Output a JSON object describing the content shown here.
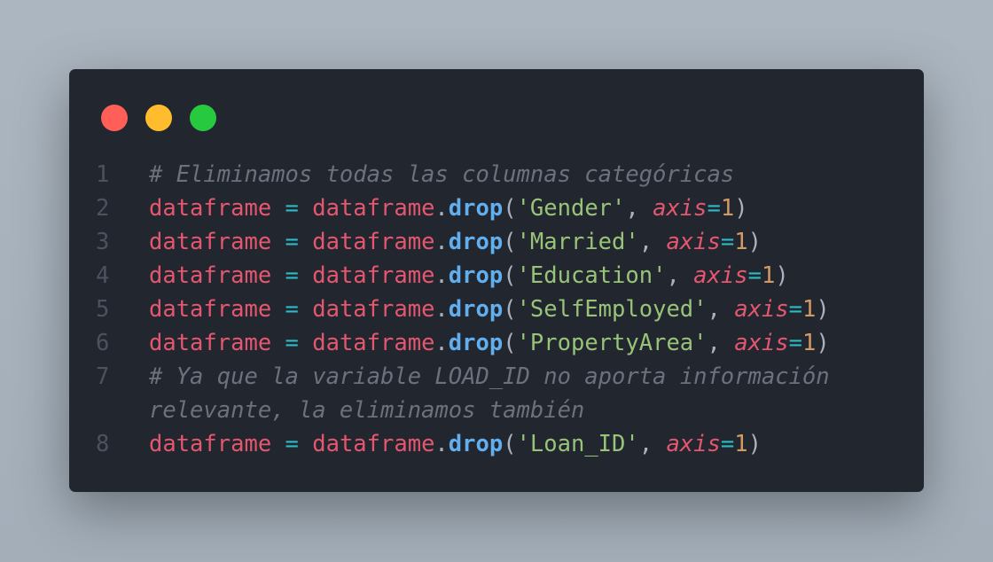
{
  "window": {
    "buttons": [
      {
        "name": "close",
        "color": "#ff5f56"
      },
      {
        "name": "minimize",
        "color": "#ffbd2e"
      },
      {
        "name": "maximize",
        "color": "#27c93f"
      }
    ]
  },
  "code": {
    "lines": [
      {
        "n": "1",
        "tokens": [
          {
            "t": "# Eliminamos todas las columnas categóricas",
            "c": "comment"
          }
        ]
      },
      {
        "n": "2",
        "tokens": [
          {
            "t": "dataframe",
            "c": "var"
          },
          {
            "t": " ",
            "c": "punc"
          },
          {
            "t": "=",
            "c": "op"
          },
          {
            "t": " ",
            "c": "punc"
          },
          {
            "t": "dataframe",
            "c": "var"
          },
          {
            "t": ".",
            "c": "punc"
          },
          {
            "t": "drop",
            "c": "fn"
          },
          {
            "t": "(",
            "c": "punc"
          },
          {
            "t": "'Gender'",
            "c": "str"
          },
          {
            "t": ", ",
            "c": "punc"
          },
          {
            "t": "axis",
            "c": "kw"
          },
          {
            "t": "=",
            "c": "op"
          },
          {
            "t": "1",
            "c": "num"
          },
          {
            "t": ")",
            "c": "punc"
          }
        ]
      },
      {
        "n": "3",
        "tokens": [
          {
            "t": "dataframe",
            "c": "var"
          },
          {
            "t": " ",
            "c": "punc"
          },
          {
            "t": "=",
            "c": "op"
          },
          {
            "t": " ",
            "c": "punc"
          },
          {
            "t": "dataframe",
            "c": "var"
          },
          {
            "t": ".",
            "c": "punc"
          },
          {
            "t": "drop",
            "c": "fn"
          },
          {
            "t": "(",
            "c": "punc"
          },
          {
            "t": "'Married'",
            "c": "str"
          },
          {
            "t": ", ",
            "c": "punc"
          },
          {
            "t": "axis",
            "c": "kw"
          },
          {
            "t": "=",
            "c": "op"
          },
          {
            "t": "1",
            "c": "num"
          },
          {
            "t": ")",
            "c": "punc"
          }
        ]
      },
      {
        "n": "4",
        "tokens": [
          {
            "t": "dataframe",
            "c": "var"
          },
          {
            "t": " ",
            "c": "punc"
          },
          {
            "t": "=",
            "c": "op"
          },
          {
            "t": " ",
            "c": "punc"
          },
          {
            "t": "dataframe",
            "c": "var"
          },
          {
            "t": ".",
            "c": "punc"
          },
          {
            "t": "drop",
            "c": "fn"
          },
          {
            "t": "(",
            "c": "punc"
          },
          {
            "t": "'Education'",
            "c": "str"
          },
          {
            "t": ", ",
            "c": "punc"
          },
          {
            "t": "axis",
            "c": "kw"
          },
          {
            "t": "=",
            "c": "op"
          },
          {
            "t": "1",
            "c": "num"
          },
          {
            "t": ")",
            "c": "punc"
          }
        ]
      },
      {
        "n": "5",
        "tokens": [
          {
            "t": "dataframe",
            "c": "var"
          },
          {
            "t": " ",
            "c": "punc"
          },
          {
            "t": "=",
            "c": "op"
          },
          {
            "t": " ",
            "c": "punc"
          },
          {
            "t": "dataframe",
            "c": "var"
          },
          {
            "t": ".",
            "c": "punc"
          },
          {
            "t": "drop",
            "c": "fn"
          },
          {
            "t": "(",
            "c": "punc"
          },
          {
            "t": "'SelfEmployed'",
            "c": "str"
          },
          {
            "t": ", ",
            "c": "punc"
          },
          {
            "t": "axis",
            "c": "kw"
          },
          {
            "t": "=",
            "c": "op"
          },
          {
            "t": "1",
            "c": "num"
          },
          {
            "t": ")",
            "c": "punc"
          }
        ]
      },
      {
        "n": "6",
        "tokens": [
          {
            "t": "dataframe",
            "c": "var"
          },
          {
            "t": " ",
            "c": "punc"
          },
          {
            "t": "=",
            "c": "op"
          },
          {
            "t": " ",
            "c": "punc"
          },
          {
            "t": "dataframe",
            "c": "var"
          },
          {
            "t": ".",
            "c": "punc"
          },
          {
            "t": "drop",
            "c": "fn"
          },
          {
            "t": "(",
            "c": "punc"
          },
          {
            "t": "'PropertyArea'",
            "c": "str"
          },
          {
            "t": ", ",
            "c": "punc"
          },
          {
            "t": "axis",
            "c": "kw"
          },
          {
            "t": "=",
            "c": "op"
          },
          {
            "t": "1",
            "c": "num"
          },
          {
            "t": ")",
            "c": "punc"
          }
        ]
      },
      {
        "n": "7",
        "tokens": [
          {
            "t": "# Ya que la variable LOAD_ID no aporta información relevante, la eliminamos también",
            "c": "comment"
          }
        ]
      },
      {
        "n": "8",
        "tokens": [
          {
            "t": "dataframe",
            "c": "var"
          },
          {
            "t": " ",
            "c": "punc"
          },
          {
            "t": "=",
            "c": "op"
          },
          {
            "t": " ",
            "c": "punc"
          },
          {
            "t": "dataframe",
            "c": "var"
          },
          {
            "t": ".",
            "c": "punc"
          },
          {
            "t": "drop",
            "c": "fn"
          },
          {
            "t": "(",
            "c": "punc"
          },
          {
            "t": "'Loan_ID'",
            "c": "str"
          },
          {
            "t": ", ",
            "c": "punc"
          },
          {
            "t": "axis",
            "c": "kw"
          },
          {
            "t": "=",
            "c": "op"
          },
          {
            "t": "1",
            "c": "num"
          },
          {
            "t": ")",
            "c": "punc"
          }
        ]
      }
    ]
  }
}
